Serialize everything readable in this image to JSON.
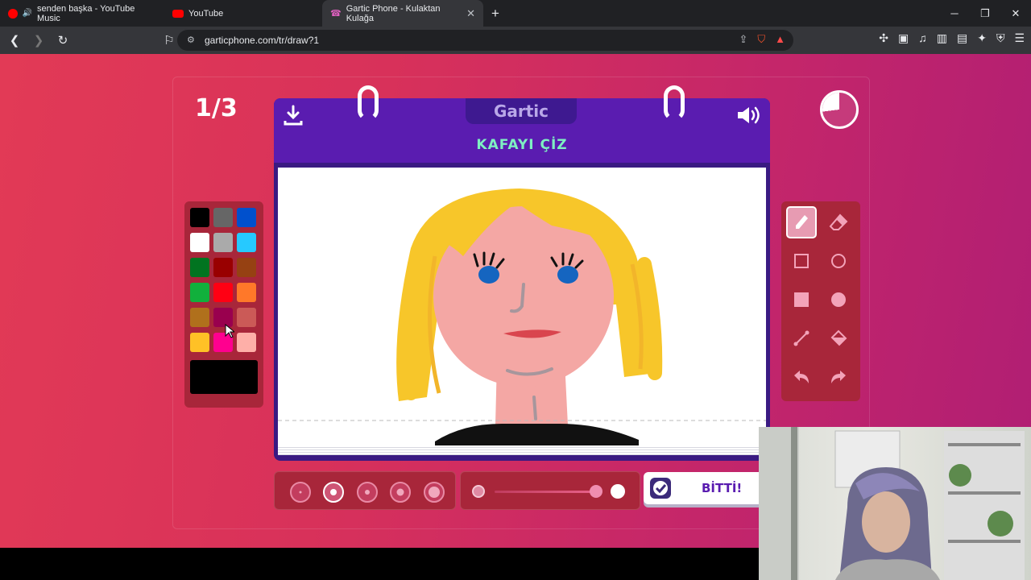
{
  "browser": {
    "tabs": [
      {
        "title": "senden başka - YouTube Music",
        "active": false
      },
      {
        "title": "YouTube",
        "active": false
      },
      {
        "title": "Gartic Phone - Kulaktan Kulağa",
        "active": true
      }
    ],
    "url": "garticphone.com/tr/draw?1"
  },
  "game": {
    "round": "1/3",
    "logo": "Gartic",
    "instruction": "KAFAYI ÇİZ",
    "done_label": "BİTTİ!",
    "timer_remaining_fraction": 0.73
  },
  "palette": {
    "colors": [
      "#000000",
      "#666666",
      "#0050cd",
      "#ffffff",
      "#aaaaaa",
      "#26c9ff",
      "#017420",
      "#990000",
      "#964112",
      "#11b03c",
      "#ff0013",
      "#ff7829",
      "#b0701c",
      "#99004e",
      "#cb5a57",
      "#ffc126",
      "#ff008f",
      "#feafa8"
    ],
    "selected_color": "#000000"
  },
  "tools": [
    "pencil-icon",
    "eraser-icon",
    "rect-outline-icon",
    "circle-outline-icon",
    "rect-fill-icon",
    "circle-fill-icon",
    "line-icon",
    "bucket-icon",
    "undo-icon",
    "redo-icon"
  ],
  "brush_sizes_selected_index": 1,
  "opacity_level": 1.0
}
